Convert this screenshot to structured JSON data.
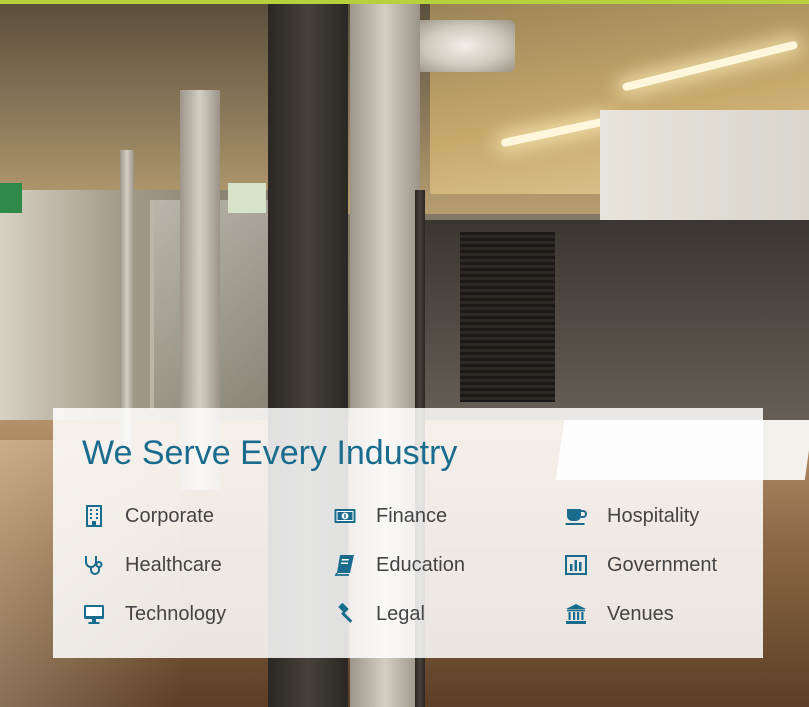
{
  "panel": {
    "title": "We Serve Every Industry",
    "industries": [
      {
        "label": "Corporate",
        "icon": "building-icon"
      },
      {
        "label": "Finance",
        "icon": "money-icon"
      },
      {
        "label": "Hospitality",
        "icon": "coffee-cup-icon"
      },
      {
        "label": "Healthcare",
        "icon": "stethoscope-icon"
      },
      {
        "label": "Education",
        "icon": "book-icon"
      },
      {
        "label": "Government",
        "icon": "bar-chart-icon"
      },
      {
        "label": "Technology",
        "icon": "desktop-icon"
      },
      {
        "label": "Legal",
        "icon": "gavel-icon"
      },
      {
        "label": "Venues",
        "icon": "institution-icon"
      }
    ]
  },
  "colors": {
    "accent_bar": "#b6d23a",
    "title": "#1a6c8e",
    "icon": "#1a6c8e",
    "label": "#444444",
    "panel_bg": "rgba(255,255,255,0.86)"
  }
}
